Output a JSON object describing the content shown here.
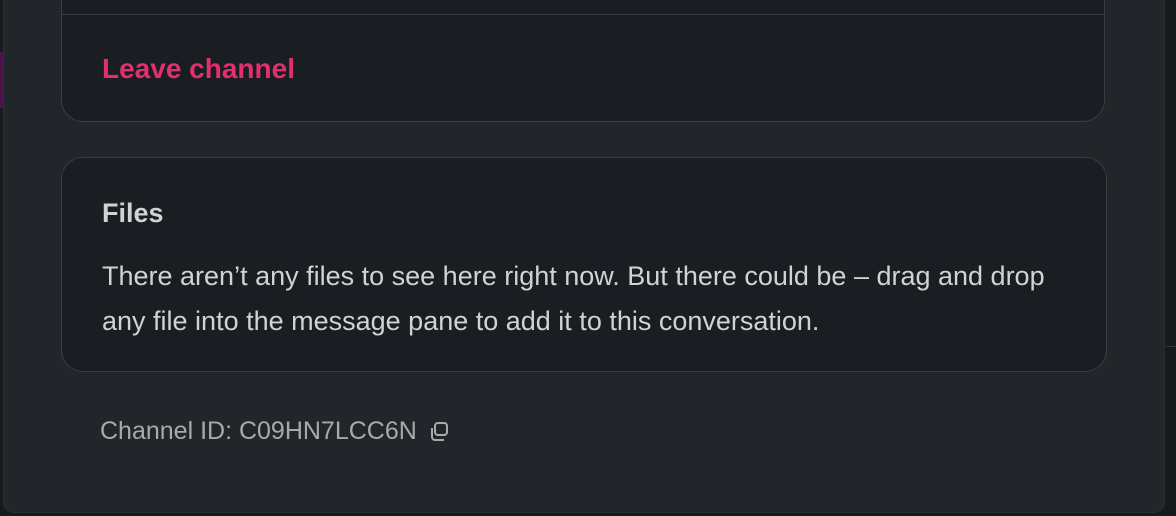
{
  "channel_details": {
    "leave_label": "Leave channel",
    "files": {
      "title": "Files",
      "empty_message": "There aren’t any files to see here right now. But there could be – drag and drop any file into the message pane to add it to this conversation."
    },
    "channel_id_text": "Channel ID: C09HN7LCC6N",
    "copy_icon": "copy-icon"
  },
  "colors": {
    "background": "#1a1d21",
    "modal": "#222529",
    "danger": "#e2306c",
    "text": "#d1d2d3",
    "muted": "#a8a9ab",
    "border": "#3a3d41"
  }
}
